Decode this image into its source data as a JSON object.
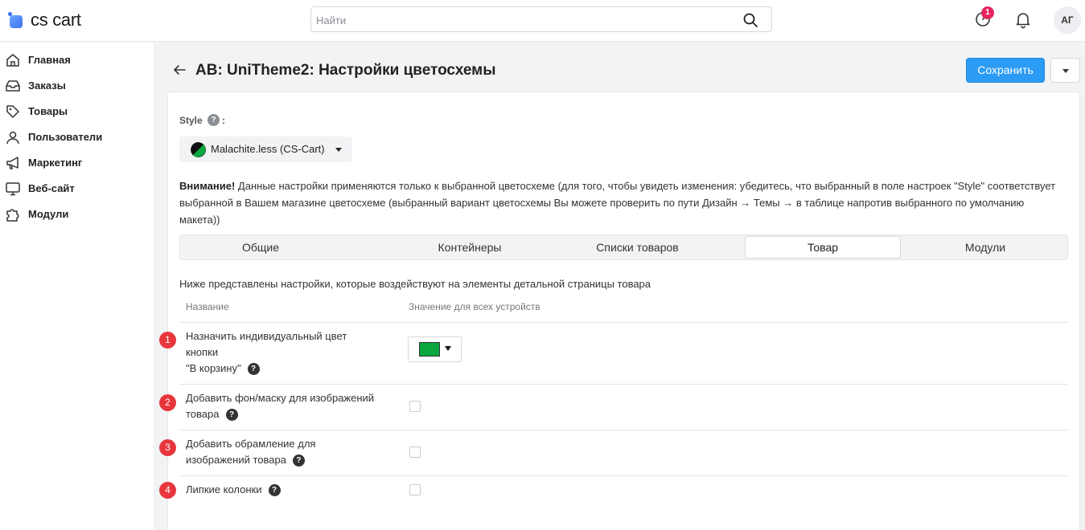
{
  "app": {
    "logo_text": "cs cart",
    "search_placeholder": "Найти",
    "notification_count": "1",
    "avatar_initials": "АГ"
  },
  "sidebar": {
    "items": [
      {
        "label": "Главная",
        "icon": "home-icon"
      },
      {
        "label": "Заказы",
        "icon": "inbox-icon"
      },
      {
        "label": "Товары",
        "icon": "tag-icon"
      },
      {
        "label": "Пользователи",
        "icon": "user-icon"
      },
      {
        "label": "Маркетинг",
        "icon": "megaphone-icon"
      },
      {
        "label": "Веб-сайт",
        "icon": "monitor-icon"
      },
      {
        "label": "Модули",
        "icon": "puzzle-icon"
      }
    ]
  },
  "header": {
    "title": "AB: UniTheme2: Настройки цветосхемы",
    "save_label": "Сохранить"
  },
  "style": {
    "label": "Style",
    "help": "?",
    "colon": ":",
    "value": "Malachite.less (CS-Cart)"
  },
  "notice": {
    "bold": "Внимание!",
    "text": " Данные настройки применяются только к выбранной цветосхеме (для того, чтобы увидеть изменения: убедитесь, что выбранный в поле настроек \"Style\" соответствует выбранной в Вашем магазине цветосхеме (выбранный вариант цветосхемы Вы можете проверить по пути Дизайн → Темы → в таблице напротив выбранного по умолчанию макета))"
  },
  "tabs": [
    {
      "label": "Общие",
      "active": false
    },
    {
      "label": "Контейнеры",
      "active": false
    },
    {
      "label": "Списки товаров",
      "active": false
    },
    {
      "label": "Товар",
      "active": true
    },
    {
      "label": "Модули",
      "active": false
    }
  ],
  "section": {
    "description": "Ниже представлены настройки, которые воздействуют на элементы детальной страницы товара",
    "col_name": "Название",
    "col_value": "Значение для всех устройств"
  },
  "settings": [
    {
      "number": "1",
      "line1": "Назначить индивидуальный цвет",
      "line2": "кнопки",
      "line3": "\"В корзину\"",
      "help": "?",
      "color": "#0aa73f",
      "type": "color"
    },
    {
      "number": "2",
      "line1": "Добавить фон/маску для изображений",
      "line2": "товара",
      "help": "?",
      "type": "checkbox",
      "checked": false
    },
    {
      "number": "3",
      "line1": "Добавить обрамление для",
      "line2": "изображений товара",
      "help": "?",
      "type": "checkbox",
      "checked": false
    },
    {
      "number": "4",
      "line1": "Липкие колонки",
      "help": "?",
      "type": "checkbox",
      "checked": false
    }
  ],
  "colors": {
    "accent": "#2b9bf4",
    "badge": "#e5245e",
    "marker": "#e8363d",
    "button_color": "#0aa73f"
  }
}
